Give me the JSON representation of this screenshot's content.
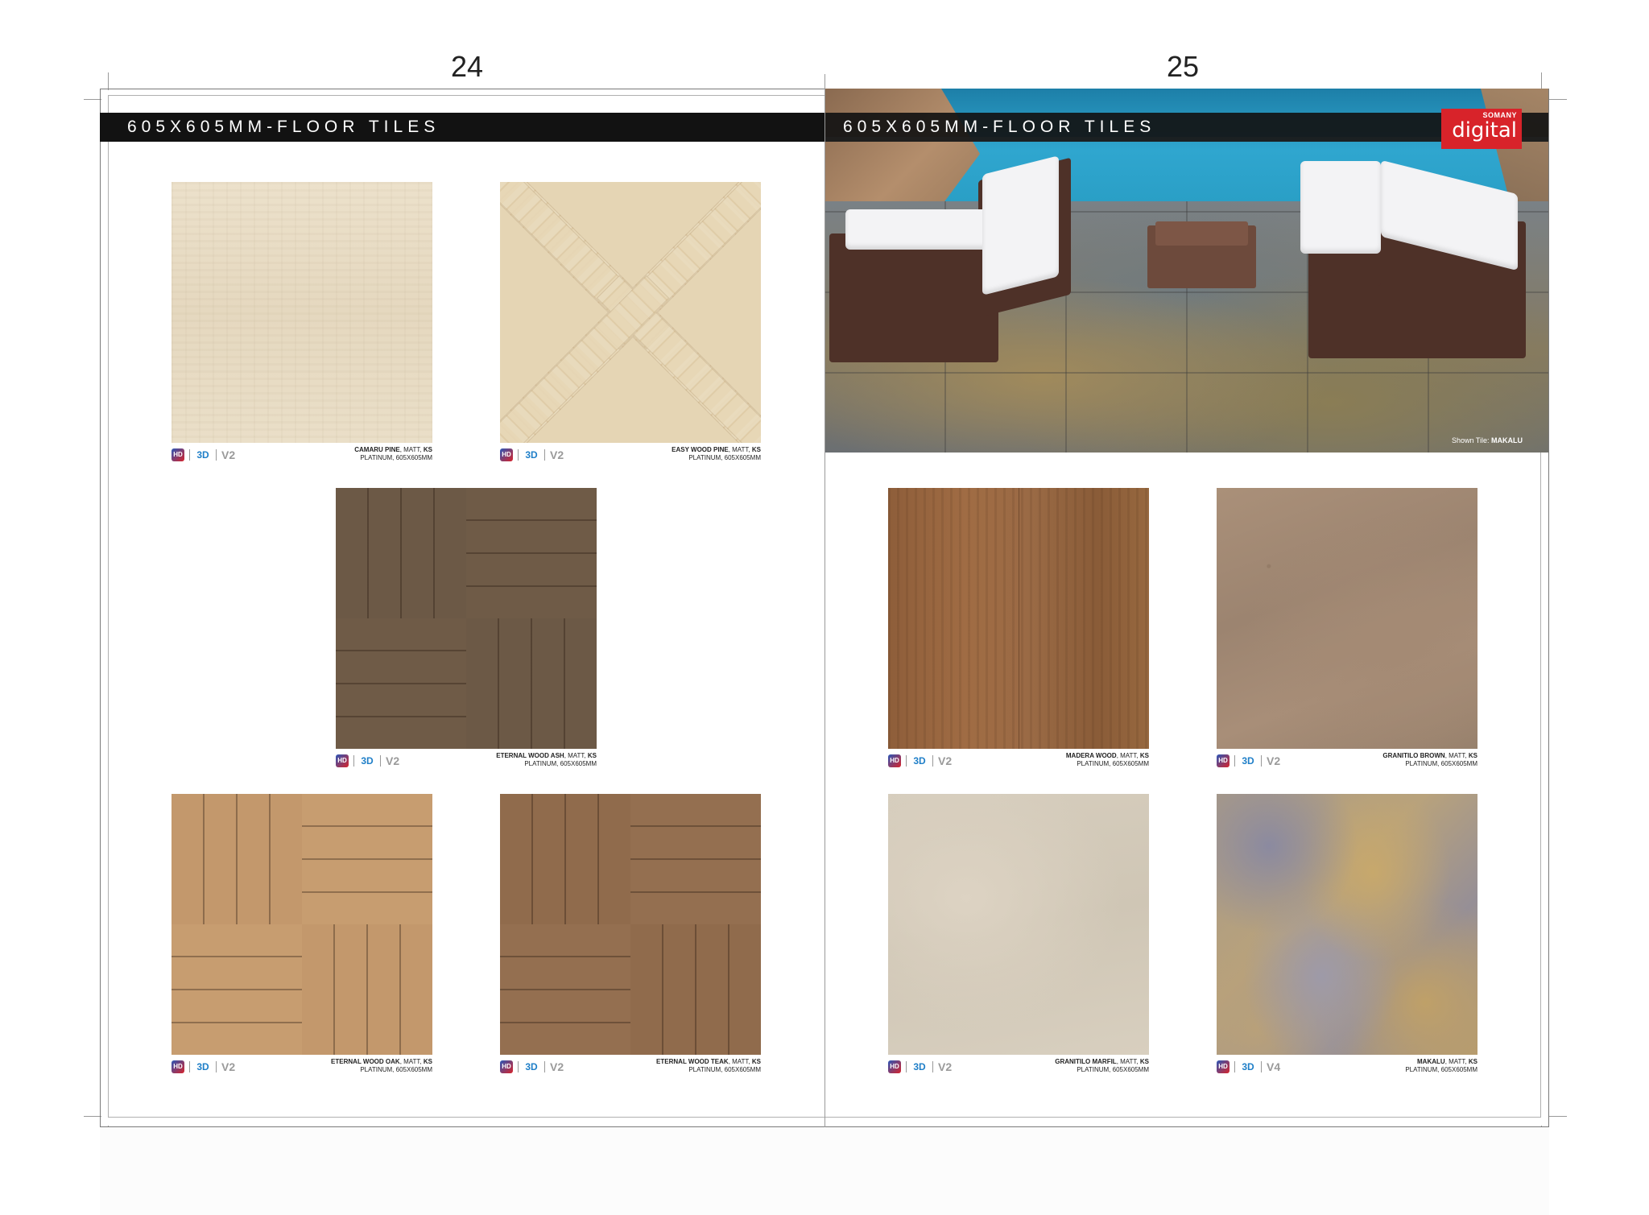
{
  "pages": {
    "left_number": "24",
    "right_number": "25"
  },
  "left_page": {
    "title": "605X605MM-FLOOR TILES"
  },
  "right_page": {
    "title": "605X605MM-FLOOR TILES",
    "logo": {
      "brand": "SOMANY",
      "word": "digital"
    },
    "photo": {
      "shown_label": "Shown Tile:",
      "shown_name": "MAKALU"
    }
  },
  "icons": {
    "hd": "HD",
    "three_d": "3D"
  },
  "tiles": [
    {
      "name": "CAMARU PINE",
      "finish": ", MATT, ",
      "code": "KS",
      "spec": "PLATINUM, 605X605MM",
      "variation": "V2"
    },
    {
      "name": "EASY WOOD PINE",
      "finish": ", MATT, ",
      "code": "KS",
      "spec": "PLATINUM, 605X605MM",
      "variation": "V2"
    },
    {
      "name": "ETERNAL WOOD ASH",
      "finish": ", MATT, ",
      "code": "KS",
      "spec": "PLATINUM, 605X605MM",
      "variation": "V2"
    },
    {
      "name": "ETERNAL WOOD OAK",
      "finish": ", MATT, ",
      "code": "KS",
      "spec": "PLATINUM, 605X605MM",
      "variation": "V2"
    },
    {
      "name": "ETERNAL WOOD TEAK",
      "finish": ", MATT, ",
      "code": "KS",
      "spec": "PLATINUM, 605X605MM",
      "variation": "V2"
    },
    {
      "name": "MADERA WOOD",
      "finish": ", MATT, ",
      "code": "KS",
      "spec": "PLATINUM, 605X605MM",
      "variation": "V2"
    },
    {
      "name": "GRANITILO BROWN",
      "finish": ", MATT, ",
      "code": "KS",
      "spec": "PLATINUM, 605X605MM",
      "variation": "V2"
    },
    {
      "name": "GRANITILO MARFIL",
      "finish": ", MATT, ",
      "code": "KS",
      "spec": "PLATINUM, 605X605MM",
      "variation": "V2"
    },
    {
      "name": "MAKALU",
      "finish": ", MATT, ",
      "code": "KS",
      "spec": "PLATINUM, 605X605MM",
      "variation": "V4"
    }
  ]
}
